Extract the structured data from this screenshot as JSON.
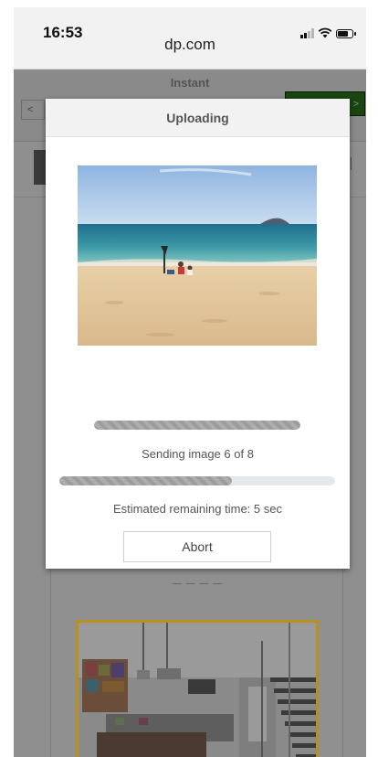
{
  "status_bar": {
    "time": "16:53",
    "url": "dp.com",
    "icons": [
      "signal-icon",
      "wifi-icon",
      "battery-icon"
    ]
  },
  "background_page": {
    "title": "Instant",
    "back_label": "<",
    "next_label": ">",
    "accent_color": "#2e7d1e"
  },
  "upload_dialog": {
    "title": "Uploading",
    "image_progress": 1.0,
    "status_text": "Sending image 6 of 8",
    "total_progress": 0.625,
    "remaining_text": "Estimated remaining time:  5 sec",
    "abort_label": "Abort"
  }
}
